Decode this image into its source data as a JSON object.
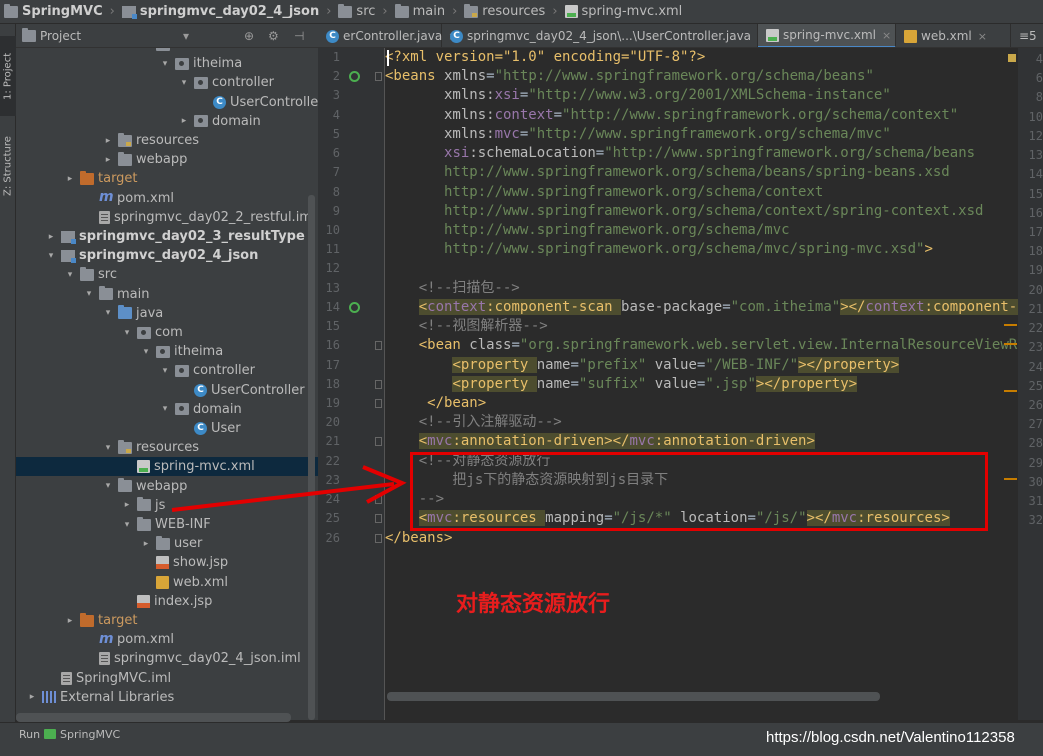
{
  "breadcrumb": [
    "SpringMVC",
    "springmvc_day02_4_json",
    "src",
    "main",
    "resources",
    "spring-mvc.xml"
  ],
  "left_tabs": {
    "project": "1: Project",
    "structure": "Z: Structure"
  },
  "project_panel": {
    "title": "Project",
    "dropdown": "▾",
    "controls": [
      "⊕",
      "⚙",
      "⊣"
    ]
  },
  "tree": [
    {
      "label": "com",
      "depth": 6,
      "icon": "pkg",
      "arrow": "▾"
    },
    {
      "label": "itheima",
      "depth": 7,
      "icon": "pkg",
      "arrow": "▾"
    },
    {
      "label": "controller",
      "depth": 8,
      "icon": "pkg",
      "arrow": "▾"
    },
    {
      "label": "UserController",
      "depth": 9,
      "icon": "class"
    },
    {
      "label": "domain",
      "depth": 8,
      "icon": "pkg",
      "arrow": "▸"
    },
    {
      "label": "resources",
      "depth": 4,
      "icon": "folder-res",
      "arrow": "▸"
    },
    {
      "label": "webapp",
      "depth": 4,
      "icon": "folder",
      "arrow": "▸"
    },
    {
      "label": "target",
      "depth": 2,
      "icon": "folder-orange",
      "arrow": "▸"
    },
    {
      "label": "pom.xml",
      "depth": 3,
      "icon": "m"
    },
    {
      "label": "springmvc_day02_2_restful.iml",
      "depth": 3,
      "icon": "file"
    },
    {
      "label": "springmvc_day02_3_resultType",
      "depth": 1,
      "icon": "module",
      "arrow": "▸",
      "bold": true
    },
    {
      "label": "springmvc_day02_4_json",
      "depth": 1,
      "icon": "module",
      "arrow": "▾",
      "bold": true
    },
    {
      "label": "src",
      "depth": 2,
      "icon": "folder",
      "arrow": "▾"
    },
    {
      "label": "main",
      "depth": 3,
      "icon": "folder",
      "arrow": "▾"
    },
    {
      "label": "java",
      "depth": 4,
      "icon": "folder-blue",
      "arrow": "▾"
    },
    {
      "label": "com",
      "depth": 5,
      "icon": "pkg",
      "arrow": "▾"
    },
    {
      "label": "itheima",
      "depth": 6,
      "icon": "pkg",
      "arrow": "▾"
    },
    {
      "label": "controller",
      "depth": 7,
      "icon": "pkg",
      "arrow": "▾"
    },
    {
      "label": "UserController",
      "depth": 8,
      "icon": "class"
    },
    {
      "label": "domain",
      "depth": 7,
      "icon": "pkg",
      "arrow": "▾"
    },
    {
      "label": "User",
      "depth": 8,
      "icon": "class"
    },
    {
      "label": "resources",
      "depth": 4,
      "icon": "folder-res",
      "arrow": "▾"
    },
    {
      "label": "spring-mvc.xml",
      "depth": 5,
      "icon": "xml",
      "selected": true
    },
    {
      "label": "webapp",
      "depth": 4,
      "icon": "folder",
      "arrow": "▾"
    },
    {
      "label": "js",
      "depth": 5,
      "icon": "folder",
      "arrow": "▸"
    },
    {
      "label": "WEB-INF",
      "depth": 5,
      "icon": "folder",
      "arrow": "▾"
    },
    {
      "label": "user",
      "depth": 6,
      "icon": "folder",
      "arrow": "▸"
    },
    {
      "label": "show.jsp",
      "depth": 6,
      "icon": "jsp"
    },
    {
      "label": "web.xml",
      "depth": 6,
      "icon": "web"
    },
    {
      "label": "index.jsp",
      "depth": 5,
      "icon": "jsp"
    },
    {
      "label": "target",
      "depth": 2,
      "icon": "folder-orange",
      "arrow": "▸"
    },
    {
      "label": "pom.xml",
      "depth": 3,
      "icon": "m"
    },
    {
      "label": "springmvc_day02_4_json.iml",
      "depth": 3,
      "icon": "file"
    },
    {
      "label": "SpringMVC.iml",
      "depth": 1,
      "icon": "file"
    },
    {
      "label": "External Libraries",
      "depth": 0,
      "icon": "lib",
      "arrow": "▸"
    }
  ],
  "tabs": [
    {
      "label": "erController.java",
      "icon": "class"
    },
    {
      "label": "springmvc_day02_4_json\\...\\UserController.java",
      "icon": "class"
    },
    {
      "label": "spring-mvc.xml",
      "icon": "xml",
      "active": true
    },
    {
      "label": "web.xml",
      "icon": "web"
    },
    {
      "label": "≡5",
      "icon": ""
    }
  ],
  "code_lines": [
    [
      {
        "t": "<?xml version=\"1.0\" encoding=\"UTF-8\"?>",
        "c": "t"
      }
    ],
    [
      {
        "t": "<beans ",
        "c": "t"
      },
      {
        "t": "xmlns",
        "c": "a"
      },
      {
        "t": "=",
        "c": ""
      },
      {
        "t": "\"http://www.springframework.org/schema/beans\"",
        "c": "s"
      }
    ],
    [
      {
        "t": "       xmlns:",
        "c": "a"
      },
      {
        "t": "xsi",
        "c": "ns"
      },
      {
        "t": "=",
        "c": ""
      },
      {
        "t": "\"http://www.w3.org/2001/XMLSchema-instance\"",
        "c": "s"
      }
    ],
    [
      {
        "t": "       xmlns:",
        "c": "a"
      },
      {
        "t": "context",
        "c": "ns"
      },
      {
        "t": "=",
        "c": ""
      },
      {
        "t": "\"http://www.springframework.org/schema/context\"",
        "c": "s"
      }
    ],
    [
      {
        "t": "       xmlns:",
        "c": "a"
      },
      {
        "t": "mvc",
        "c": "ns"
      },
      {
        "t": "=",
        "c": ""
      },
      {
        "t": "\"http://www.springframework.org/schema/mvc\"",
        "c": "s"
      }
    ],
    [
      {
        "t": "       ",
        "c": ""
      },
      {
        "t": "xsi",
        "c": "ns"
      },
      {
        "t": ":schemaLocation",
        "c": "a"
      },
      {
        "t": "=",
        "c": ""
      },
      {
        "t": "\"http://www.springframework.org/schema/beans",
        "c": "s"
      }
    ],
    [
      {
        "t": "       http://www.springframework.org/schema/beans/spring-beans.xsd",
        "c": "s"
      }
    ],
    [
      {
        "t": "       http://www.springframework.org/schema/context",
        "c": "s"
      }
    ],
    [
      {
        "t": "       http://www.springframework.org/schema/context/spring-context.xsd",
        "c": "s"
      }
    ],
    [
      {
        "t": "       http://www.springframework.org/schema/mvc",
        "c": "s"
      }
    ],
    [
      {
        "t": "       http://www.springframework.org/schema/mvc/spring-mvc.xsd\"",
        "c": "s"
      },
      {
        "t": ">",
        "c": "t"
      }
    ],
    [],
    [
      {
        "t": "    <!--扫描包-->",
        "c": "c"
      }
    ],
    [
      {
        "t": "    ",
        "c": ""
      },
      {
        "t": "<",
        "c": "t tb"
      },
      {
        "t": "context",
        "c": "ns tb"
      },
      {
        "t": ":component-scan ",
        "c": "t tb"
      },
      {
        "t": "base-package",
        "c": "a"
      },
      {
        "t": "=",
        "c": ""
      },
      {
        "t": "\"com.itheima\"",
        "c": "s"
      },
      {
        "t": "></",
        "c": "t tb"
      },
      {
        "t": "context",
        "c": "ns tb"
      },
      {
        "t": ":component-scan>",
        "c": "t tb"
      }
    ],
    [
      {
        "t": "    <!--视图解析器-->",
        "c": "c"
      }
    ],
    [
      {
        "t": "    <bean ",
        "c": "t"
      },
      {
        "t": "class",
        "c": "a"
      },
      {
        "t": "=",
        "c": ""
      },
      {
        "t": "\"org.springframework.web.servlet.view.InternalResourceViewResolver\"",
        "c": "s"
      },
      {
        "t": ">",
        "c": "t"
      }
    ],
    [
      {
        "t": "        ",
        "c": ""
      },
      {
        "t": "<property ",
        "c": "t tb"
      },
      {
        "t": "name",
        "c": "a"
      },
      {
        "t": "=",
        "c": ""
      },
      {
        "t": "\"prefix\" ",
        "c": "s"
      },
      {
        "t": "value",
        "c": "a"
      },
      {
        "t": "=",
        "c": ""
      },
      {
        "t": "\"/WEB-INF/\"",
        "c": "s"
      },
      {
        "t": "></property>",
        "c": "t tb"
      }
    ],
    [
      {
        "t": "        ",
        "c": ""
      },
      {
        "t": "<property ",
        "c": "t tb"
      },
      {
        "t": "name",
        "c": "a"
      },
      {
        "t": "=",
        "c": ""
      },
      {
        "t": "\"suffix\" ",
        "c": "s"
      },
      {
        "t": "value",
        "c": "a"
      },
      {
        "t": "=",
        "c": ""
      },
      {
        "t": "\".jsp\"",
        "c": "s"
      },
      {
        "t": "></property>",
        "c": "t tb"
      }
    ],
    [
      {
        "t": "     </bean>",
        "c": "t"
      }
    ],
    [
      {
        "t": "    <!--引入注解驱动-->",
        "c": "c"
      }
    ],
    [
      {
        "t": "    ",
        "c": ""
      },
      {
        "t": "<",
        "c": "t tb"
      },
      {
        "t": "mvc",
        "c": "ns tb"
      },
      {
        "t": ":annotation-driven></",
        "c": "t tb"
      },
      {
        "t": "mvc",
        "c": "ns tb"
      },
      {
        "t": ":annotation-driven>",
        "c": "t tb"
      }
    ],
    [
      {
        "t": "    <!--对静态资源放行",
        "c": "c"
      }
    ],
    [
      {
        "t": "        把js下的静态资源映射到js目录下",
        "c": "c"
      }
    ],
    [
      {
        "t": "    -->",
        "c": "c"
      }
    ],
    [
      {
        "t": "    ",
        "c": ""
      },
      {
        "t": "<",
        "c": "t tb"
      },
      {
        "t": "mvc",
        "c": "ns tb"
      },
      {
        "t": ":resources ",
        "c": "t tb"
      },
      {
        "t": "mapping",
        "c": "a"
      },
      {
        "t": "=",
        "c": ""
      },
      {
        "t": "\"/js/*\" ",
        "c": "s"
      },
      {
        "t": "location",
        "c": "a"
      },
      {
        "t": "=",
        "c": ""
      },
      {
        "t": "\"/js/\"",
        "c": "s"
      },
      {
        "t": "></",
        "c": "t tb"
      },
      {
        "t": "mvc",
        "c": "ns tb"
      },
      {
        "t": ":resources>",
        "c": "t tb"
      }
    ],
    [
      {
        "t": "</beans>",
        "c": "t"
      }
    ]
  ],
  "right_gutter": [
    "4",
    "6",
    "8",
    "10",
    "12",
    "13",
    "14",
    "15",
    "16",
    "17",
    "18",
    "19",
    "20",
    "21",
    "22",
    "23",
    "24",
    "25",
    "26",
    "27",
    "28",
    "29",
    "30",
    "31",
    "32"
  ],
  "annotation": "对静态资源放行",
  "bottom_bar": {
    "run_label": "Run",
    "run_target": "SpringMVC"
  },
  "watermark": "https://blog.csdn.net/Valentino112358"
}
